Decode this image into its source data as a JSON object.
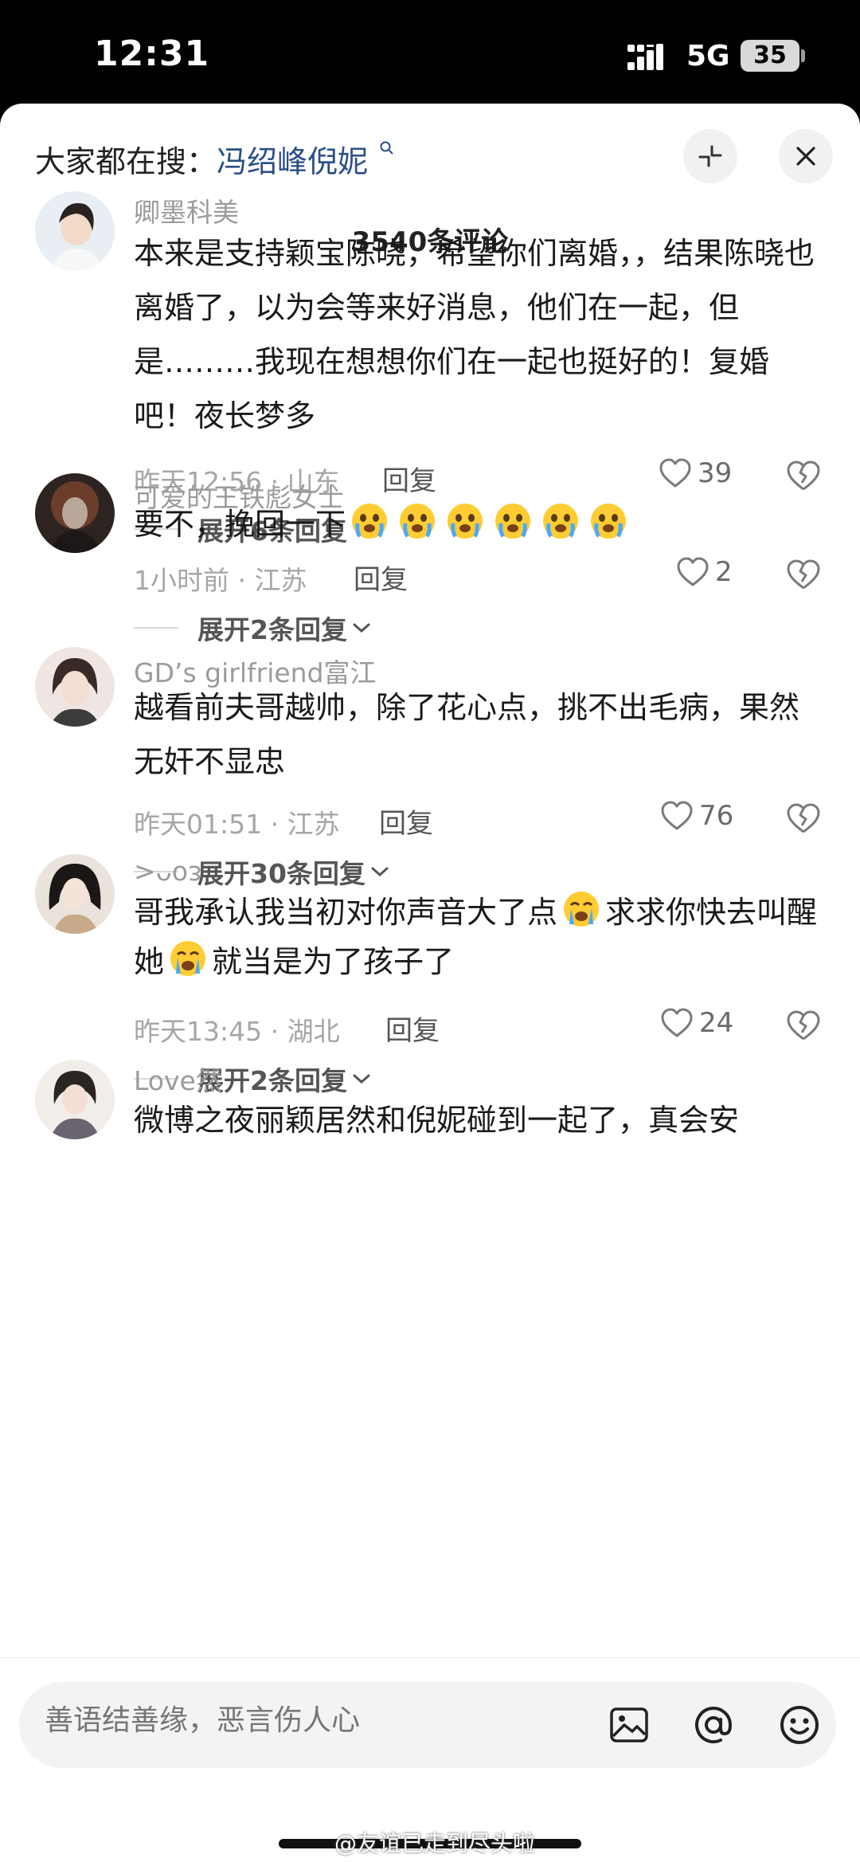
{
  "status": {
    "time": "12:31",
    "network": "5G",
    "battery": "35"
  },
  "header": {
    "search_prefix": "大家都在搜：",
    "search_keyword": "冯绍峰倪妮",
    "count_title": "3540条评论"
  },
  "comments": [
    {
      "user": "卿墨科美",
      "text": "本来是支持颖宝陈晓，希望你们离婚，，结果陈晓也离婚了，以为会等来好消息，他们在一起，但是………我现在想想你们在一起也挺好的！复婚吧！夜长梦多",
      "meta": "昨天12:56 · 山东",
      "reply": "回复",
      "likes": "39",
      "expand": "展开6条回复"
    },
    {
      "user": "可爱的王铁彪女士",
      "text": "要不，挽回一下",
      "emoji_count": 6,
      "meta": "1小时前 · 江苏",
      "reply": "回复",
      "likes": "2",
      "expand": "展开2条回复"
    },
    {
      "user": "GD’s girlfriend富江",
      "text": "越看前夫哥越帅，除了花心点，挑不出毛病，果然无奸不显忠",
      "meta": "昨天01:51 · 江苏",
      "reply": "回复",
      "likes": "76",
      "expand": "展开30条回复"
    },
    {
      "user": ">ᴗoᴈ",
      "text_a": "哥我承认我当初对你声音大了点",
      "text_b": "求求你快去叫醒她",
      "text_c": "就当是为了孩子了",
      "meta": "昨天13:45 · 湖北",
      "reply": "回复",
      "likes": "24",
      "expand": "展开2条回复"
    },
    {
      "user": "Love然",
      "text": "微博之夜丽颖居然和倪妮碰到一起了，真会安"
    }
  ],
  "input": {
    "placeholder": "善语结善缘，恶言伤人心"
  },
  "watermark": "@友谊已走到尽头啦",
  "colors": {
    "keyword": "#2a4f86",
    "secondary_text": "#9b9b9b",
    "sheet_bg": "#ffffff"
  }
}
